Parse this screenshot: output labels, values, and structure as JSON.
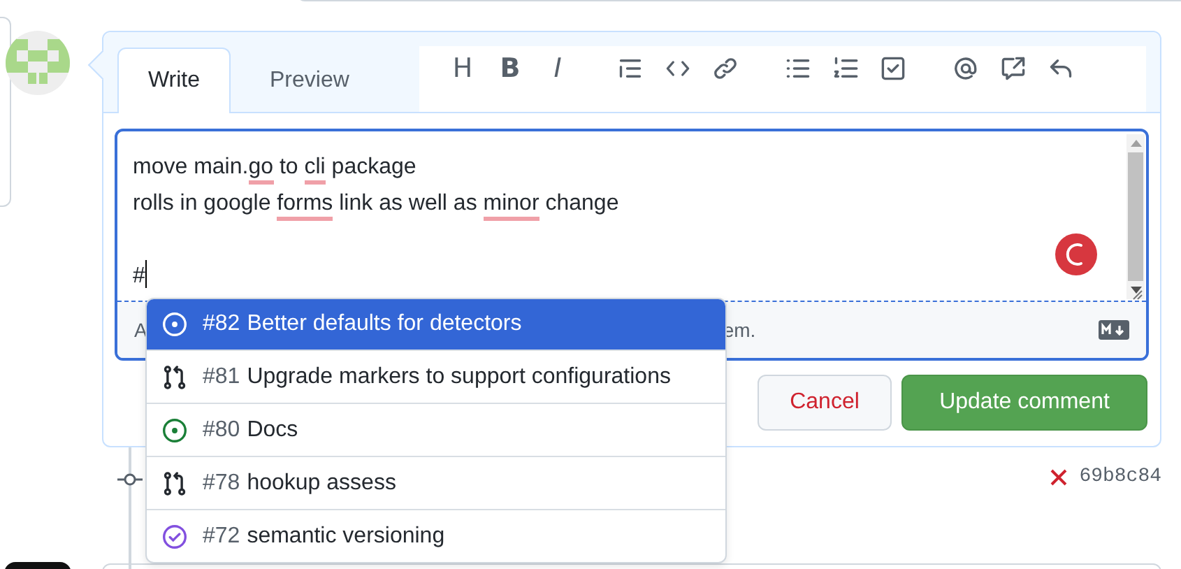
{
  "editor": {
    "tabs": [
      {
        "label": "Write",
        "selected": true
      },
      {
        "label": "Preview",
        "selected": false
      }
    ],
    "toolbar": [
      {
        "kind": "glyph",
        "glyph": "H"
      },
      {
        "kind": "glyph",
        "glyph": "B"
      },
      {
        "kind": "glyph",
        "glyph": "I"
      },
      {
        "kind": "gap"
      },
      {
        "kind": "quote"
      },
      {
        "kind": "code"
      },
      {
        "kind": "link"
      },
      {
        "kind": "gap"
      },
      {
        "kind": "bullets"
      },
      {
        "kind": "numbers"
      },
      {
        "kind": "tasks"
      },
      {
        "kind": "gap"
      },
      {
        "kind": "mention"
      },
      {
        "kind": "reference"
      },
      {
        "kind": "reply"
      }
    ],
    "lines": [
      [
        {
          "text": "move main.",
          "misspelled": false
        },
        {
          "text": "go",
          "misspelled": true
        },
        {
          "text": " to ",
          "misspelled": false
        },
        {
          "text": "cli",
          "misspelled": true
        },
        {
          "text": " package",
          "misspelled": false
        }
      ],
      [
        {
          "text": "rolls in google ",
          "misspelled": false
        },
        {
          "text": "forms",
          "misspelled": true
        },
        {
          "text": " link as well as ",
          "misspelled": false
        },
        {
          "text": "minor",
          "misspelled": true
        },
        {
          "text": " change",
          "misspelled": false
        }
      ],
      [
        {
          "text": "#",
          "misspelled": false
        }
      ]
    ],
    "footer_left": "A",
    "footer_right": "em.",
    "buttons": [
      {
        "label": "Cancel",
        "kind": "cancel"
      },
      {
        "label": "Update comment",
        "kind": "primary"
      }
    ]
  },
  "suggestions": [
    {
      "number": "#82",
      "title": "Better defaults for detectors",
      "kind": "issue-open",
      "selected": true
    },
    {
      "number": "#81",
      "title": "Upgrade markers to support configurations",
      "kind": "pull-request",
      "selected": false
    },
    {
      "number": "#80",
      "title": "Docs",
      "kind": "issue-open",
      "selected": false
    },
    {
      "number": "#78",
      "title": "hookup assess",
      "kind": "pull-request",
      "selected": false
    },
    {
      "number": "#72",
      "title": "semantic versioning",
      "kind": "issue-closed",
      "selected": false
    }
  ],
  "commit": {
    "sha": "69b8c84"
  }
}
